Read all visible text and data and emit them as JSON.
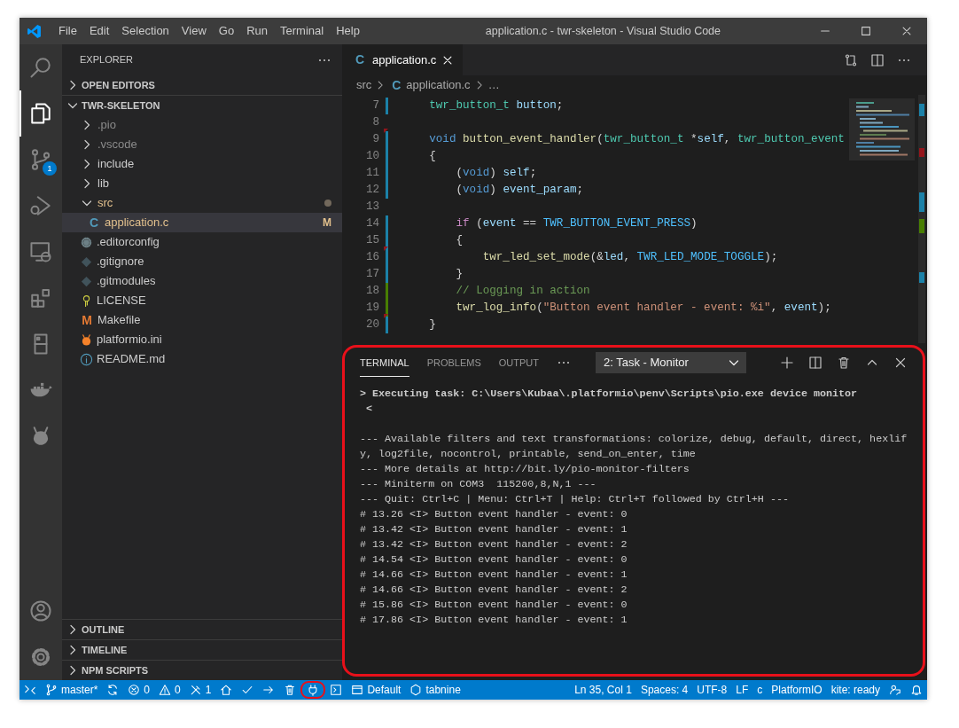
{
  "window": {
    "title": "application.c - twr-skeleton - Visual Studio Code"
  },
  "menu": [
    "File",
    "Edit",
    "Selection",
    "View",
    "Go",
    "Run",
    "Terminal",
    "Help"
  ],
  "activity_bar": {
    "items": [
      {
        "kind": "search",
        "selected": false
      },
      {
        "kind": "files",
        "selected": true
      },
      {
        "kind": "git",
        "badge": "1",
        "selected": false
      },
      {
        "kind": "debug",
        "selected": false
      },
      {
        "kind": "remote",
        "selected": false
      },
      {
        "kind": "extensions",
        "selected": false
      },
      {
        "kind": "device",
        "selected": false
      },
      {
        "kind": "docker",
        "selected": false
      },
      {
        "kind": "alien",
        "selected": false
      }
    ],
    "bottom": [
      {
        "kind": "account"
      },
      {
        "kind": "settings"
      }
    ]
  },
  "explorer": {
    "title": "EXPLORER",
    "sections": [
      {
        "title": "OPEN EDITORS",
        "expanded": false
      },
      {
        "title": "TWR-SKELETON",
        "expanded": true,
        "items": [
          {
            "label": ".pio",
            "kind": "folder",
            "expanded": false,
            "dimmed": true,
            "modified": false,
            "selected": false
          },
          {
            "label": ".vscode",
            "kind": "folder",
            "expanded": false,
            "dimmed": true,
            "modified": false,
            "selected": false
          },
          {
            "label": "include",
            "kind": "folder",
            "expanded": false,
            "dimmed": false,
            "modified": false,
            "selected": false
          },
          {
            "label": "lib",
            "kind": "folder",
            "expanded": false,
            "dimmed": false,
            "modified": false,
            "selected": false
          },
          {
            "label": "src",
            "kind": "folder",
            "expanded": true,
            "dimmed": false,
            "modified": true,
            "selected": false,
            "children": [
              {
                "label": "application.c",
                "kind": "c",
                "glyph": "C",
                "badge": "M",
                "dimmed": false,
                "modified": true,
                "selected": true
              }
            ]
          },
          {
            "label": ".editorconfig",
            "kind": "gear",
            "dimmed": false,
            "modified": false,
            "selected": false
          },
          {
            "label": ".gitignore",
            "kind": "diamond",
            "dimmed": false,
            "modified": false,
            "selected": false
          },
          {
            "label": ".gitmodules",
            "kind": "diamond",
            "dimmed": false,
            "modified": false,
            "selected": false
          },
          {
            "label": "LICENSE",
            "kind": "key",
            "dimmed": false,
            "modified": false,
            "selected": false
          },
          {
            "label": "Makefile",
            "kind": "makefile",
            "glyph": "M",
            "dimmed": false,
            "modified": false,
            "selected": false
          },
          {
            "label": "platformio.ini",
            "kind": "ant",
            "dimmed": false,
            "modified": false,
            "selected": false
          },
          {
            "label": "README.md",
            "kind": "info",
            "dimmed": false,
            "modified": false,
            "selected": false
          }
        ]
      },
      {
        "title": "OUTLINE",
        "expanded": false
      },
      {
        "title": "TIMELINE",
        "expanded": false
      },
      {
        "title": "NPM SCRIPTS",
        "expanded": false
      }
    ]
  },
  "editor": {
    "tabs": [
      {
        "glyph": "C",
        "label": "application.c",
        "selected": true
      }
    ],
    "breadcrumbs": [
      {
        "text": "src"
      },
      {
        "glyph": "C",
        "text": "application.c"
      },
      {
        "text": "…"
      }
    ],
    "lines": [
      {
        "number": "7",
        "kind": "modified",
        "tokens": [
          {
            "kind": "type",
            "text": "    twr_button_t"
          },
          {
            "kind": "var",
            "text": " button"
          },
          {
            "kind": "plain",
            "text": ";"
          }
        ]
      },
      {
        "number": "8",
        "kind": "unchanged"
      },
      {
        "number": "9",
        "kind": "modified",
        "deleted": true,
        "tokens": [
          {
            "kind": "keyword",
            "text": "    void"
          },
          {
            "kind": "func",
            "text": " button_event_handler"
          },
          {
            "kind": "plain",
            "text": "("
          },
          {
            "kind": "type",
            "text": "twr_button_t"
          },
          {
            "kind": "plain",
            "text": " *"
          },
          {
            "kind": "var",
            "text": "self"
          },
          {
            "kind": "plain",
            "text": ", "
          },
          {
            "kind": "type",
            "text": "twr_button_event"
          }
        ]
      },
      {
        "number": "10",
        "kind": "modified",
        "tokens": [
          {
            "kind": "plain",
            "text": "    {"
          }
        ]
      },
      {
        "number": "11",
        "kind": "modified",
        "tokens": [
          {
            "kind": "plain",
            "text": "        ("
          },
          {
            "kind": "keyword",
            "text": "void"
          },
          {
            "kind": "plain",
            "text": ") "
          },
          {
            "kind": "var",
            "text": "self"
          },
          {
            "kind": "plain",
            "text": ";"
          }
        ]
      },
      {
        "number": "12",
        "kind": "modified",
        "tokens": [
          {
            "kind": "plain",
            "text": "        ("
          },
          {
            "kind": "keyword",
            "text": "void"
          },
          {
            "kind": "plain",
            "text": ") "
          },
          {
            "kind": "var",
            "text": "event_param"
          },
          {
            "kind": "plain",
            "text": ";"
          }
        ]
      },
      {
        "number": "13",
        "kind": "unchanged"
      },
      {
        "number": "14",
        "kind": "modified",
        "tokens": [
          {
            "kind": "control",
            "text": "        if"
          },
          {
            "kind": "plain",
            "text": " ("
          },
          {
            "kind": "var",
            "text": "event"
          },
          {
            "kind": "plain",
            "text": " == "
          },
          {
            "kind": "const",
            "text": "TWR_BUTTON_EVENT_PRESS"
          },
          {
            "kind": "plain",
            "text": ")"
          }
        ]
      },
      {
        "number": "15",
        "kind": "modified",
        "tokens": [
          {
            "kind": "plain",
            "text": "        {"
          }
        ]
      },
      {
        "number": "16",
        "kind": "modified",
        "deleted": true,
        "tokens": [
          {
            "kind": "func",
            "text": "            twr_led_set_mode"
          },
          {
            "kind": "plain",
            "text": "(&"
          },
          {
            "kind": "var",
            "text": "led"
          },
          {
            "kind": "plain",
            "text": ", "
          },
          {
            "kind": "const",
            "text": "TWR_LED_MODE_TOGGLE"
          },
          {
            "kind": "plain",
            "text": ");"
          }
        ]
      },
      {
        "number": "17",
        "kind": "modified",
        "tokens": [
          {
            "kind": "plain",
            "text": "        }"
          }
        ]
      },
      {
        "number": "18",
        "kind": "added",
        "tokens": [
          {
            "kind": "comment",
            "text": "        // Logging in action"
          }
        ]
      },
      {
        "number": "19",
        "kind": "added",
        "tokens": [
          {
            "kind": "func",
            "text": "        twr_log_info"
          },
          {
            "kind": "plain",
            "text": "("
          },
          {
            "kind": "string",
            "text": "\"Button event handler - event: %i\""
          },
          {
            "kind": "plain",
            "text": ", "
          },
          {
            "kind": "var",
            "text": "event"
          },
          {
            "kind": "plain",
            "text": ");"
          }
        ]
      },
      {
        "number": "20",
        "kind": "modified",
        "deleted": true,
        "tokens": [
          {
            "kind": "plain",
            "text": "    }"
          }
        ]
      }
    ]
  },
  "panel": {
    "tabs": [
      {
        "label": "TERMINAL",
        "selected": true
      },
      {
        "label": "PROBLEMS",
        "selected": false
      },
      {
        "label": "OUTPUT",
        "selected": false
      }
    ],
    "terminal_select": "2: Task - Monitor",
    "lines": [
      {
        "kind": "task",
        "text": "> Executing task: C:\\Users\\Kubaa\\.platformio\\penv\\Scripts\\pio.exe device monitor"
      },
      {
        "kind": "task",
        "text": " <"
      },
      {
        "kind": "output",
        "space_before": true,
        "text": "--- Available filters and text transformations: colorize, debug, default, direct, hexlif"
      },
      {
        "kind": "output",
        "text": "y, log2file, nocontrol, printable, send_on_enter, time"
      },
      {
        "kind": "output",
        "text": "--- More details at http://bit.ly/pio-monitor-filters"
      },
      {
        "kind": "output",
        "text": "--- Miniterm on COM3  115200,8,N,1 ---"
      },
      {
        "kind": "output",
        "text": "--- Quit: Ctrl+C | Menu: Ctrl+T | Help: Ctrl+T followed by Ctrl+H ---"
      },
      {
        "kind": "output",
        "text": "# 13.26 <I> Button event handler - event: 0"
      },
      {
        "kind": "output",
        "text": "# 13.42 <I> Button event handler - event: 1"
      },
      {
        "kind": "output",
        "text": "# 13.42 <I> Button event handler - event: 2"
      },
      {
        "kind": "output",
        "text": "# 14.54 <I> Button event handler - event: 0"
      },
      {
        "kind": "output",
        "text": "# 14.66 <I> Button event handler - event: 1"
      },
      {
        "kind": "output",
        "text": "# 14.66 <I> Button event handler - event: 2"
      },
      {
        "kind": "output",
        "text": "# 15.86 <I> Button event handler - event: 0"
      },
      {
        "kind": "output",
        "text": "# 17.86 <I> Button event handler - event: 1"
      }
    ]
  },
  "status_bar": {
    "left": [
      {
        "kind": "remote-status",
        "highlighted": false
      },
      {
        "kind": "branch",
        "text": "master*",
        "highlighted": false
      },
      {
        "kind": "sync",
        "highlighted": false
      },
      {
        "kind": "error",
        "text": "0",
        "highlighted": false
      },
      {
        "kind": "warning",
        "text": "0",
        "highlighted": false
      },
      {
        "kind": "tools",
        "text": "1",
        "highlighted": false
      },
      {
        "kind": "home",
        "highlighted": false
      },
      {
        "kind": "check",
        "highlighted": false
      },
      {
        "kind": "arrow",
        "highlighted": false
      },
      {
        "kind": "trash",
        "highlighted": false
      },
      {
        "kind": "plug",
        "highlighted": true
      },
      {
        "kind": "terminal",
        "highlighted": false
      },
      {
        "kind": "window",
        "text": "Default",
        "highlighted": false
      },
      {
        "kind": "hexagon",
        "text": "tabnine",
        "highlighted": false
      }
    ],
    "right": [
      {
        "kind": "text",
        "text": "Ln 35, Col 1"
      },
      {
        "kind": "text",
        "text": "Spaces: 4"
      },
      {
        "kind": "text",
        "text": "UTF-8"
      },
      {
        "kind": "text",
        "text": "LF"
      },
      {
        "kind": "text",
        "text": "c"
      },
      {
        "kind": "text",
        "text": "PlatformIO"
      },
      {
        "kind": "text",
        "text": "kite: ready"
      },
      {
        "kind": "feedback"
      },
      {
        "kind": "bell"
      }
    ]
  }
}
